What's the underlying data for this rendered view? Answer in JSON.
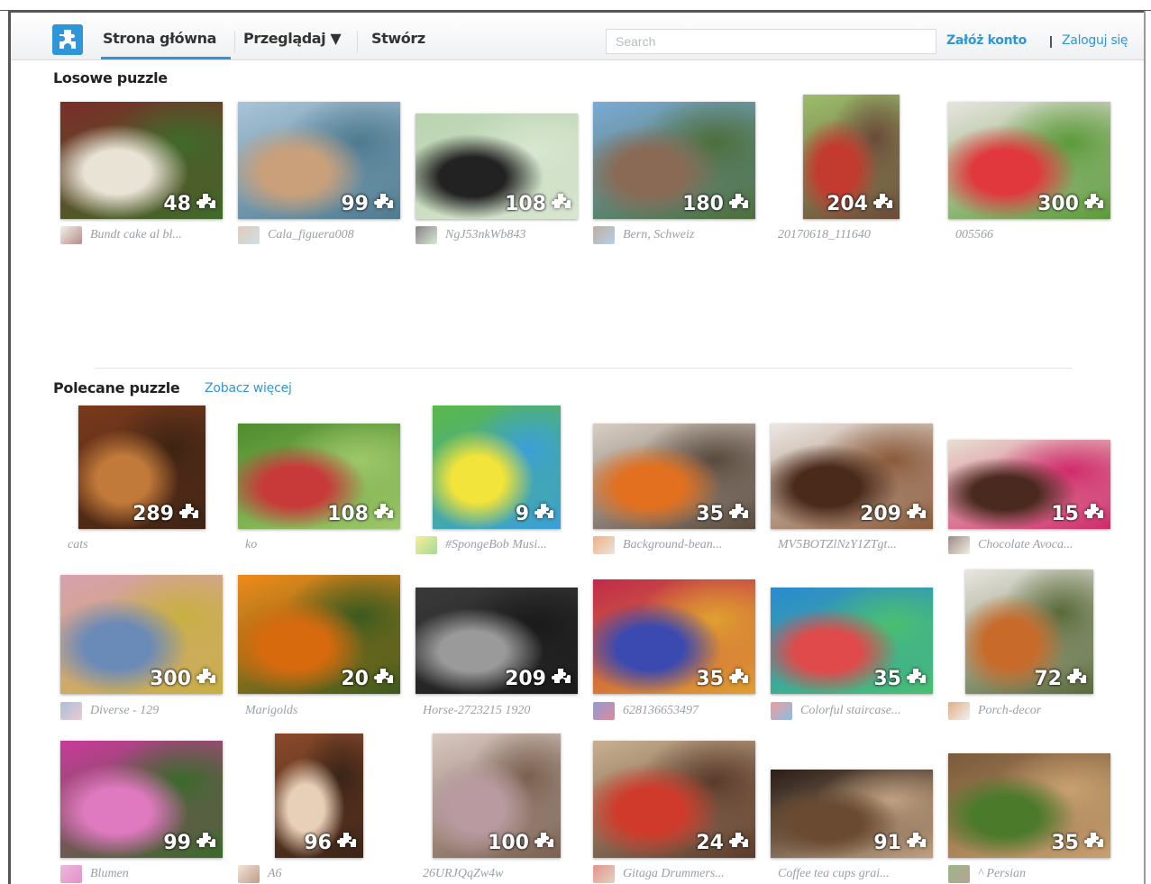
{
  "nav": {
    "home": "Strona główna",
    "browse": "Przeglądaj ▼",
    "create": "Stwórz",
    "search_placeholder": "Search",
    "register": "Załóż konto",
    "login": "Zaloguj się",
    "separator": "|"
  },
  "random": {
    "title": "Losowe puzzle",
    "items": [
      {
        "pieces": "48",
        "caption": "Bundt cake al bl...",
        "colors": [
          "#7a2e28",
          "#e9e3d6",
          "#3f6b2a"
        ]
      },
      {
        "pieces": "99",
        "caption": "Cala_figuera008",
        "colors": [
          "#a8c4d8",
          "#c9a07a",
          "#4e7a8f"
        ]
      },
      {
        "pieces": "108",
        "caption": "NgJ53nkWb843",
        "colors": [
          "#b9d3b0",
          "#222222",
          "#d8e6d0"
        ]
      },
      {
        "pieces": "180",
        "caption": "Bern, Schweiz",
        "colors": [
          "#7aaad6",
          "#8a6a55",
          "#4d6e3a"
        ]
      },
      {
        "pieces": "204",
        "caption": "20170618_111640",
        "colors": [
          "#9bbf6a",
          "#c33a2e",
          "#6b4a3a"
        ]
      },
      {
        "pieces": "300",
        "caption": "005566",
        "colors": [
          "#e8e4e0",
          "#e0383c",
          "#5c9a3a"
        ]
      }
    ]
  },
  "featured": {
    "title": "Polecane puzzle",
    "more": "Zobacz więcej",
    "items": [
      {
        "pieces": "289",
        "caption": "cats",
        "colors": [
          "#7a3a1c",
          "#c27a3a",
          "#3e2414"
        ]
      },
      {
        "pieces": "108",
        "caption": "ko",
        "colors": [
          "#4f8d2e",
          "#c83a3a",
          "#9ec86a"
        ]
      },
      {
        "pieces": "9",
        "caption": "#SpongeBob Musi...",
        "colors": [
          "#5ab848",
          "#f2e43a",
          "#3aa0d8"
        ]
      },
      {
        "pieces": "35",
        "caption": "Background-bean...",
        "colors": [
          "#d8cfc4",
          "#e2701e",
          "#5a4a3e"
        ]
      },
      {
        "pieces": "209",
        "caption": "MV5BOTZlNzY1ZTgt...",
        "colors": [
          "#ece8e4",
          "#4a2a1a",
          "#8a5a3a"
        ]
      },
      {
        "pieces": "15",
        "caption": "Chocolate Avoca...",
        "colors": [
          "#e8e0d0",
          "#4a2a1e",
          "#d02a6a"
        ]
      },
      {
        "pieces": "300",
        "caption": "Diverse - 129",
        "colors": [
          "#d8a0b0",
          "#6a8ab8",
          "#c8b040"
        ]
      },
      {
        "pieces": "20",
        "caption": "Marigolds",
        "colors": [
          "#f08a1a",
          "#d86a0e",
          "#3a5a1e"
        ]
      },
      {
        "pieces": "209",
        "caption": "Horse-2723215 1920",
        "colors": [
          "#3a3a3a",
          "#9a9a9a",
          "#1a1a1a"
        ]
      },
      {
        "pieces": "35",
        "caption": "628136653497",
        "colors": [
          "#c02a4a",
          "#3a4ab0",
          "#e0a030"
        ]
      },
      {
        "pieces": "35",
        "caption": "Colorful staircase...",
        "colors": [
          "#2a8ad0",
          "#e04a4a",
          "#4ac070"
        ]
      },
      {
        "pieces": "72",
        "caption": "Porch-decor",
        "colors": [
          "#e8e6e0",
          "#c86a2a",
          "#5a6a3a"
        ]
      },
      {
        "pieces": "99",
        "caption": "Blumen",
        "colors": [
          "#c83a9a",
          "#e07ac0",
          "#3a6a2a"
        ]
      },
      {
        "pieces": "96",
        "caption": "A6",
        "colors": [
          "#8a4a2a",
          "#e8d0b8",
          "#3a2418"
        ]
      },
      {
        "pieces": "100",
        "caption": "26URJQqZw4w",
        "colors": [
          "#d8c8c0",
          "#b89aa0",
          "#7a6050"
        ]
      },
      {
        "pieces": "24",
        "caption": "Gitaga Drummers...",
        "colors": [
          "#c8b090",
          "#d03a2a",
          "#5a3a2a"
        ]
      },
      {
        "pieces": "91",
        "caption": "Coffee tea cups grai...",
        "colors": [
          "#2a1e18",
          "#6a4a30",
          "#c0a080"
        ]
      },
      {
        "pieces": "35",
        "caption": "^ Persian",
        "colors": [
          "#7a5a3a",
          "#4a7a2a",
          "#c8a070"
        ]
      }
    ]
  }
}
